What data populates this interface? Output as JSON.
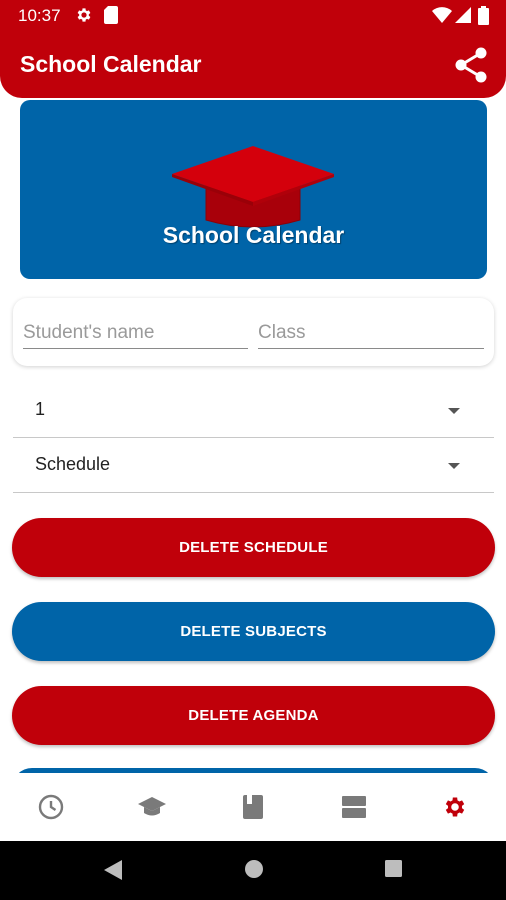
{
  "status_bar": {
    "time": "10:37",
    "icons": [
      "gear-icon",
      "sd-card-icon",
      "wifi-icon",
      "signal-icon",
      "battery-icon"
    ]
  },
  "app_bar": {
    "title": "School Calendar",
    "action_icon": "share-icon"
  },
  "banner": {
    "title": "School Calendar",
    "icon": "graduation-cap-icon"
  },
  "form": {
    "student_name": {
      "value": "",
      "placeholder": "Student's name"
    },
    "class": {
      "value": "",
      "placeholder": "Class"
    }
  },
  "dropdowns": [
    {
      "selected": "1"
    },
    {
      "selected": "Schedule"
    }
  ],
  "buttons": {
    "delete_schedule": "DELETE SCHEDULE",
    "delete_subjects": "DELETE SUBJECTS",
    "delete_agenda": "DELETE AGENDA"
  },
  "bottom_nav": {
    "items": [
      {
        "icon": "clock-icon",
        "active": false
      },
      {
        "icon": "graduation-cap-icon",
        "active": false
      },
      {
        "icon": "book-icon",
        "active": false
      },
      {
        "icon": "view-agenda-icon",
        "active": false
      },
      {
        "icon": "settings-gear-icon",
        "active": true
      }
    ]
  },
  "colors": {
    "primary_red": "#c0000a",
    "primary_blue": "#0064a8",
    "nav_inactive": "#7a7a7a",
    "nav_active": "#c0000a"
  }
}
